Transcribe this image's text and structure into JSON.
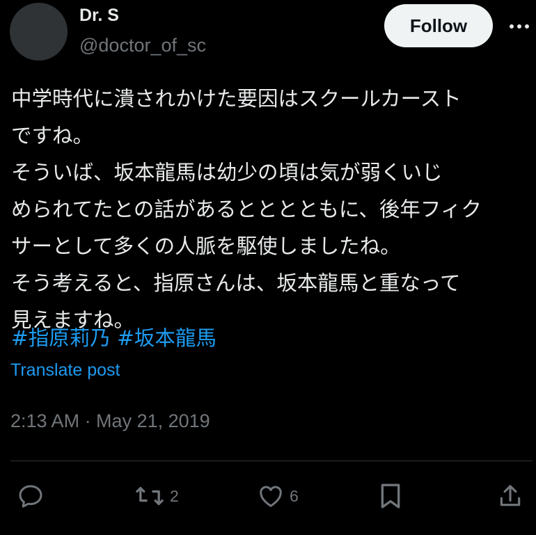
{
  "author": {
    "name": "Dr. S",
    "handle": "@doctor_of_sc"
  },
  "follow_label": "Follow",
  "post": {
    "lines": [
      "中学時代に潰されかけた要因はスクールカースト",
      "ですね。",
      "そういば、坂本龍馬は幼少の頃は気が弱くいじ",
      "められてたとの話があるとととともに、後年フィク",
      "サーとして多くの人脈を駆使しましたね。",
      "そう考えると、指原さんは、坂本龍馬と重なって",
      "見えますね。"
    ],
    "hashtags": [
      "#指原莉乃",
      "#坂本龍馬"
    ]
  },
  "translate_label": "Translate post",
  "timestamp": "2:13 AM · May 21, 2019",
  "actions": {
    "reposts": "2",
    "likes": "6"
  },
  "icons": [
    "more-icon",
    "reply-icon",
    "repost-icon",
    "like-icon",
    "bookmark-icon",
    "share-icon"
  ],
  "colors": {
    "background": "#000000",
    "text": "#e7e9ea",
    "muted": "#71767b",
    "accent": "#1d9bf0",
    "follow_bg": "#eff3f4"
  }
}
